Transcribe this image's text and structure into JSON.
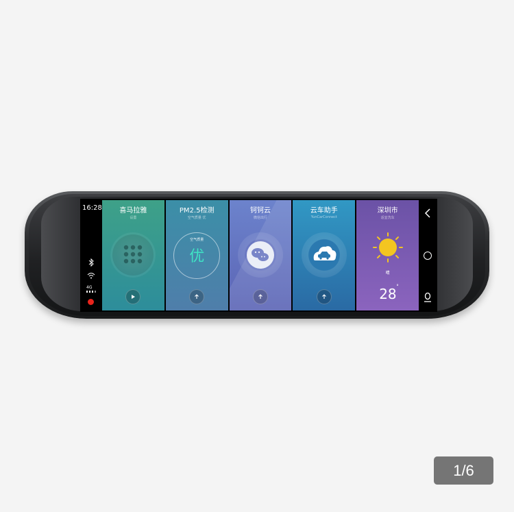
{
  "status": {
    "time": "16:28",
    "network": "4G"
  },
  "cards": [
    {
      "title": "喜马拉雅",
      "subtitle": "设置",
      "icon": "dialpad-icon"
    },
    {
      "title": "PM2.5检测",
      "subtitle": "空气质量 优",
      "air_label": "空气质量",
      "air_value": "优",
      "icon": "air-quality-icon"
    },
    {
      "title": "钶钶云",
      "subtitle": "微信出行",
      "icon": "wechat-icon"
    },
    {
      "title": "云车助手",
      "subtitle": "YunCarConnect",
      "icon": "cloud-car-icon"
    },
    {
      "title": "深圳市",
      "subtitle": "适宜洗车",
      "condition": "晴",
      "temperature": "28",
      "degree": "°",
      "icon": "sun-icon"
    }
  ],
  "pager": {
    "label": "1/6"
  },
  "colors": {
    "record": "#e8241c",
    "air_value": "#3fe3c5",
    "sun": "#f3c521"
  }
}
